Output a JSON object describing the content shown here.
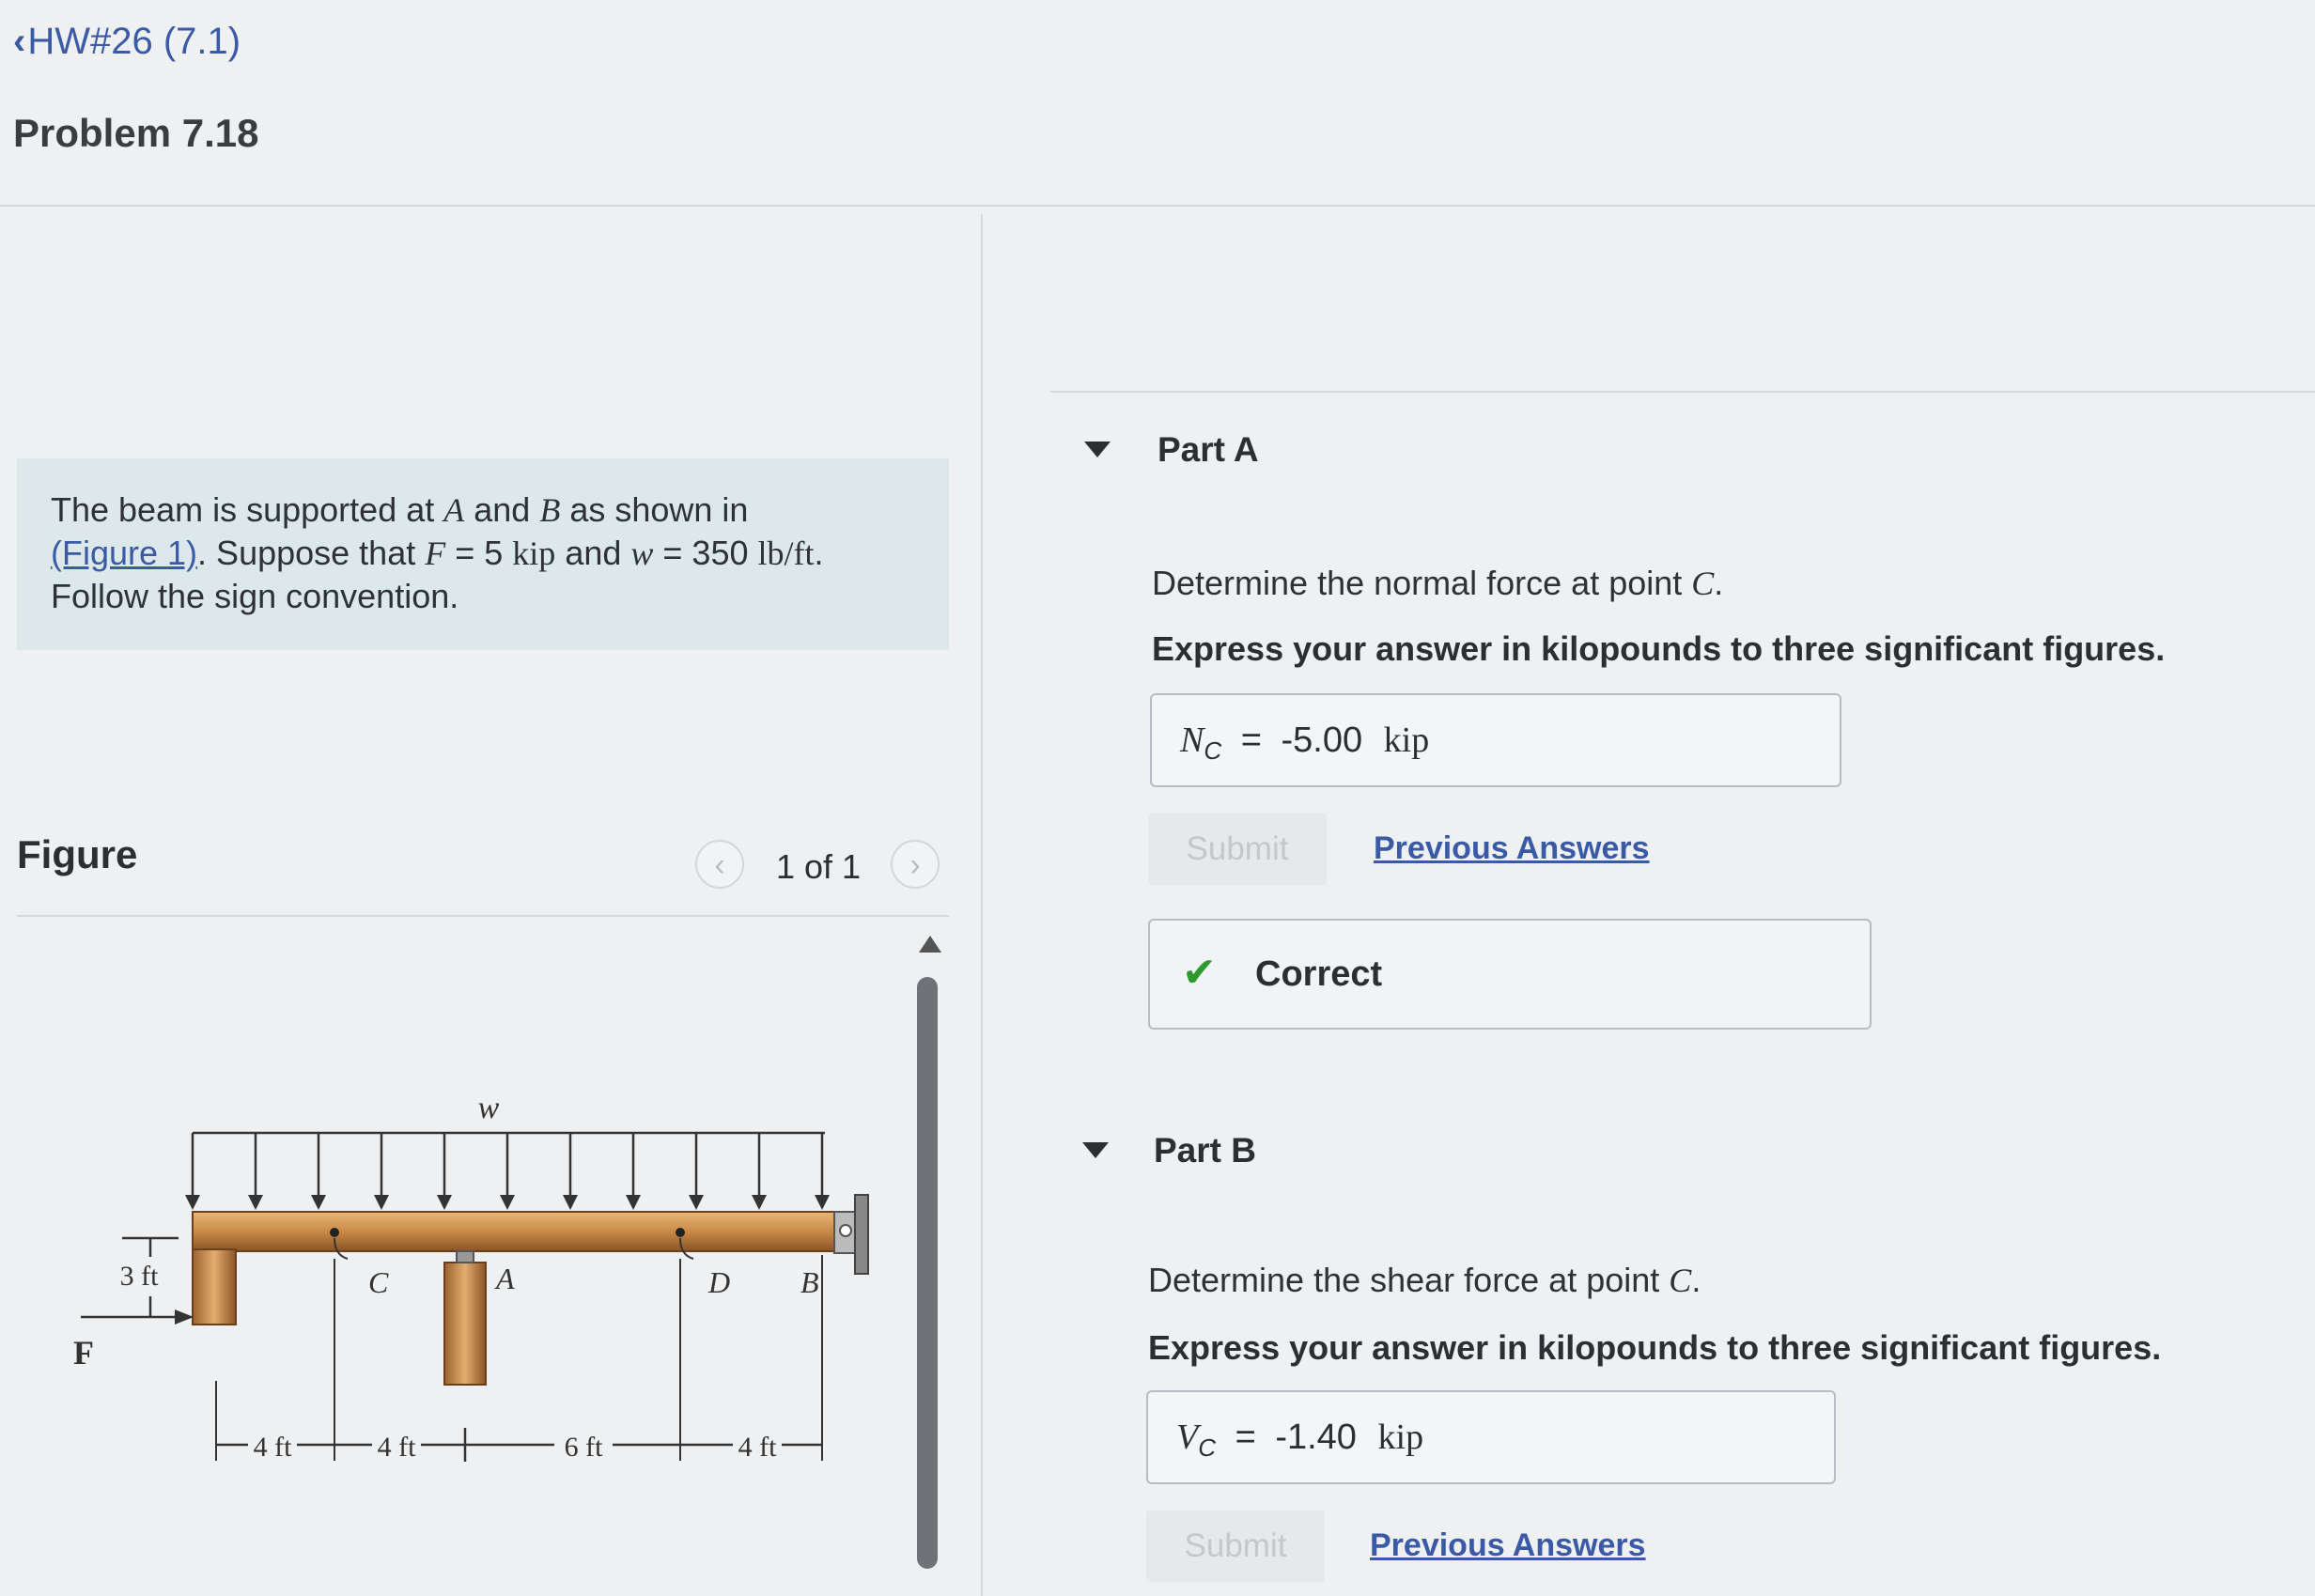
{
  "header": {
    "back_link": "HW#26 (7.1)",
    "problem_title": "Problem 7.18"
  },
  "statement": {
    "line1_a": "The beam is supported at ",
    "var_A": "A",
    "line1_b": " and ",
    "var_B": "B",
    "line1_c": " as shown in",
    "fig_link": "(Figure 1)",
    "line2_a": ". Suppose that ",
    "var_F": "F",
    "eq_F": " = 5 ",
    "unit_kip": "kip",
    "line2_b": " and ",
    "var_w": "w",
    "eq_w": " = 350 ",
    "unit_w": "lb/ft",
    "line2_c": ".",
    "line3": "Follow the sign convention."
  },
  "figure": {
    "label": "Figure",
    "count": "1 of 1",
    "prev_icon": "chevron-left-icon",
    "next_icon": "chevron-right-icon",
    "labels": {
      "w": "w",
      "three_ft": "3 ft",
      "F": "F",
      "C": "C",
      "A": "A",
      "D": "D",
      "B": "B",
      "d1": "4 ft",
      "d2": "4 ft",
      "d3": "6 ft",
      "d4": "4 ft"
    }
  },
  "part_a": {
    "title": "Part A",
    "question_prefix": "Determine the normal force at point ",
    "question_var": "C",
    "question_suffix": ".",
    "instruction": "Express your answer in kilopounds to three significant figures.",
    "answer_var": "N",
    "answer_sub": "C",
    "answer_eq": "=",
    "answer_value": "-5.00",
    "answer_unit": "kip",
    "submit": "Submit",
    "previous": "Previous Answers",
    "feedback_icon": "checkmark-icon",
    "feedback": "Correct"
  },
  "part_b": {
    "title": "Part B",
    "question_prefix": "Determine the shear force at point ",
    "question_var": "C",
    "question_suffix": ".",
    "instruction": "Express your answer in kilopounds to three significant figures.",
    "answer_var": "V",
    "answer_sub": "C",
    "answer_eq": "=",
    "answer_value": "-1.40",
    "answer_unit": "kip",
    "submit": "Submit",
    "previous": "Previous Answers"
  }
}
